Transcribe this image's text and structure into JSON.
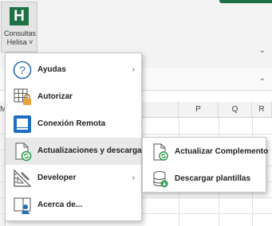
{
  "ribbon": {
    "button_icon_letter": "H",
    "button_label_line1": "Consultas",
    "button_label_line2": "Helisa ˅",
    "accent_color": "#1e7145"
  },
  "sheet": {
    "row_header_label": "M",
    "columns": [
      "P",
      "Q",
      "R"
    ]
  },
  "menu": {
    "items": [
      {
        "label": "Ayudas",
        "icon": "help-circle-icon",
        "has_submenu": true
      },
      {
        "label": "Autorizar",
        "icon": "grid-lock-icon",
        "has_submenu": false
      },
      {
        "label": "Conexión Remota",
        "icon": "remote-screen-icon",
        "has_submenu": false
      },
      {
        "label": "Actualizaciones y descargas",
        "icon": "document-sync-icon",
        "has_submenu": true
      },
      {
        "label": "Developer",
        "icon": "ruler-triangle-icon",
        "has_submenu": true
      },
      {
        "label": "Acerca de...",
        "icon": "book-user-icon",
        "has_submenu": false
      }
    ]
  },
  "submenu": {
    "items": [
      {
        "label": "Actualizar Complemento",
        "icon": "document-refresh-icon"
      },
      {
        "label": "Descargar plantillas",
        "icon": "database-download-icon"
      }
    ]
  }
}
